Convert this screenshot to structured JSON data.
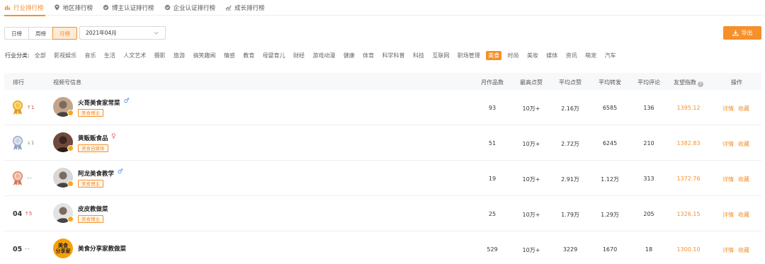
{
  "top_tabs": [
    {
      "label": "行业排行榜",
      "icon": "bar-chart-icon",
      "active": true
    },
    {
      "label": "地区排行榜",
      "icon": "location-pin-icon",
      "active": false
    },
    {
      "label": "博主认证排行榜",
      "icon": "verified-badge-icon",
      "active": false
    },
    {
      "label": "企业认证排行榜",
      "icon": "verified-badge-icon",
      "active": false
    },
    {
      "label": "成长排行榜",
      "icon": "growth-chart-icon",
      "active": false
    }
  ],
  "period": {
    "day": "日榜",
    "week": "周榜",
    "month": "月榜",
    "selected": "month"
  },
  "date_select": {
    "value": "2021年04月"
  },
  "export_label": "导出",
  "category": {
    "label": "行业分类:",
    "items": [
      "全部",
      "影视娱乐",
      "音乐",
      "生活",
      "人文艺术",
      "摄影",
      "旅游",
      "搞笑趣闻",
      "情感",
      "教育",
      "母婴育儿",
      "财经",
      "游戏动漫",
      "健康",
      "体育",
      "科学科普",
      "科技",
      "互联网",
      "职场管理",
      "美食",
      "时尚",
      "美妆",
      "媒体",
      "资讯",
      "萌宠",
      "汽车"
    ],
    "active": "美食"
  },
  "table": {
    "headers": {
      "rank": "排行",
      "info": "视频号信息",
      "monthly_works": "月作品数",
      "max_likes": "最高点赞",
      "avg_likes": "平均点赞",
      "avg_shares": "平均转发",
      "avg_comments": "平均评论",
      "index": "友望指数",
      "ops": "操作"
    },
    "rows": [
      {
        "rank": "",
        "medal": "gold",
        "trend": "1",
        "trend_dir": "up",
        "name": "火哥美食家常菜",
        "gender": "♂",
        "tag": "美食博主",
        "works": "93",
        "max_likes": "10万+",
        "avg_likes": "2.16万",
        "avg_shares": "6585",
        "avg_comments": "136",
        "index": "1395.12"
      },
      {
        "rank": "",
        "medal": "silver",
        "trend": "1",
        "trend_dir": "down",
        "name": "黄贩贩食品",
        "gender": "♀",
        "tag": "美食自媒体",
        "works": "51",
        "max_likes": "10万+",
        "avg_likes": "2.72万",
        "avg_shares": "6245",
        "avg_comments": "210",
        "index": "1382.83"
      },
      {
        "rank": "",
        "medal": "bronze",
        "trend": "--",
        "trend_dir": "same",
        "name": "阿龙美食教学",
        "gender": "♂",
        "tag": "美食博主",
        "works": "19",
        "max_likes": "10万+",
        "avg_likes": "2.91万",
        "avg_shares": "1.12万",
        "avg_comments": "313",
        "index": "1372.76"
      },
      {
        "rank": "04",
        "medal": "",
        "trend": "5",
        "trend_dir": "up",
        "name": "皮皮教做菜",
        "gender": "",
        "tag": "美食博主",
        "works": "25",
        "max_likes": "10万+",
        "avg_likes": "1.79万",
        "avg_shares": "1.29万",
        "avg_comments": "205",
        "index": "1326.15"
      },
      {
        "rank": "05",
        "medal": "",
        "trend": "--",
        "trend_dir": "same",
        "name": "美食分享家教做菜",
        "gender": "",
        "tag": "",
        "avatar_text": "美食\n分享家",
        "works": "529",
        "max_likes": "10万+",
        "avg_likes": "3229",
        "avg_shares": "1670",
        "avg_comments": "18",
        "index": "1300.10"
      }
    ],
    "op_detail": "详情",
    "op_fav": "收藏"
  },
  "colors": {
    "accent": "#f5902a",
    "up": "#e04040",
    "down": "#4caf50"
  }
}
